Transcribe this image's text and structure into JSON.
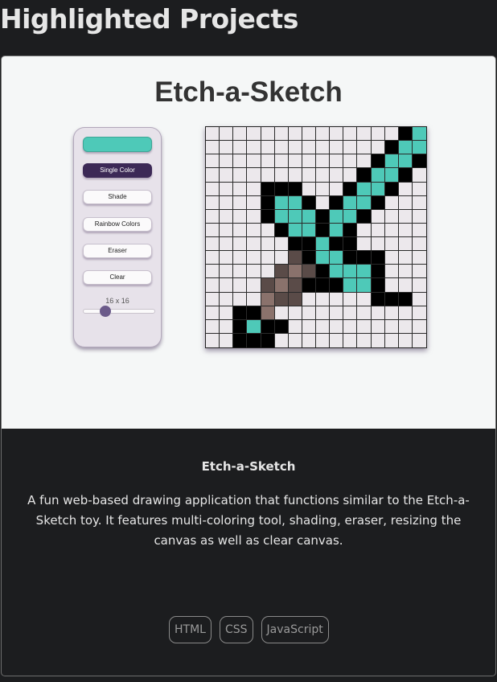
{
  "section": {
    "title": "Highlighted Projects"
  },
  "project": {
    "app_title": "Etch-a-Sketch",
    "controls": {
      "color_picker_value": "#4ec9b8",
      "buttons": [
        {
          "label": "Single Color",
          "active": true
        },
        {
          "label": "Shade",
          "active": false
        },
        {
          "label": "Rainbow Colors",
          "active": false
        },
        {
          "label": "Eraser",
          "active": false
        },
        {
          "label": "Clear",
          "active": false
        }
      ],
      "grid_size_label": "16 x 16",
      "grid_size_value": 16,
      "grid_size_fraction": 0.27
    },
    "canvas": {
      "columns": 16,
      "rows": 16,
      "palette": {
        ".": "#ece8ec",
        "B": "#000000",
        "T": "#4ec9b8",
        "D": "#5a4b48",
        "L": "#8a726c"
      },
      "pixels": [
        "..............BT",
        ".............BTT",
        "............BTTB",
        "...........BTTB.",
        "....BBB...BTTB..",
        "....BTTB.BTTB...",
        "....BTTTBTTB....",
        ".....BTTBTB.....",
        "......BBTBB.....",
        "......DBTTBBB...",
        ".....DLDBTTTB...",
        "....DLDBBBTTB...",
        "....LDD.....BBB.",
        "..BBL...........",
        "..BTBB..........",
        "..BBB..........."
      ]
    },
    "description": {
      "title": "Etch-a-Sketch",
      "text": "A fun web-based drawing application that functions similar to the Etch-a-Sketch toy. It features multi-coloring tool, shading, eraser, resizing the canvas as well as clear canvas."
    },
    "tags": [
      "HTML",
      "CSS",
      "JavaScript"
    ]
  }
}
